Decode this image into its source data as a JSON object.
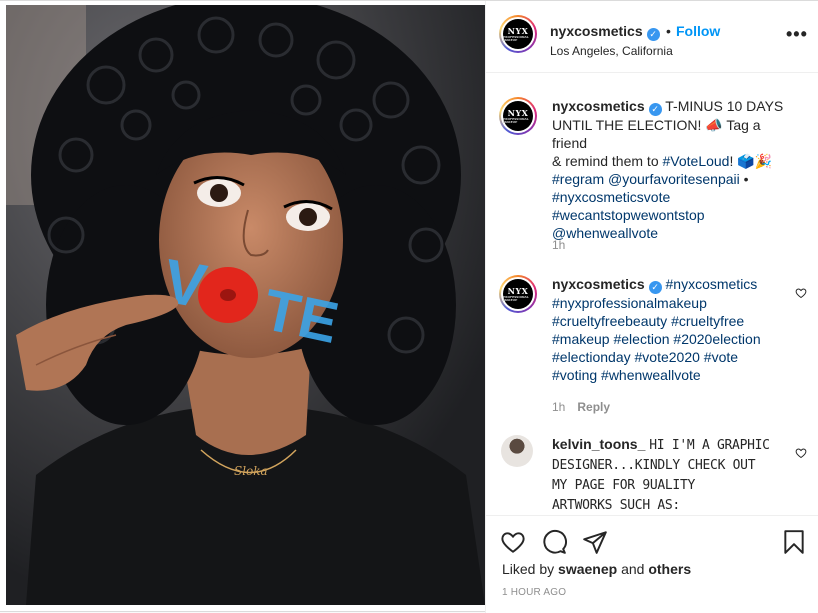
{
  "post": {
    "header": {
      "username": "nyxcosmetics",
      "separator": "•",
      "follow_label": "Follow",
      "location": "Los Angeles, California",
      "more_label": "•••",
      "avatar_logo": "NYX",
      "avatar_sub": "PROFESSIONAL MAKEUP"
    },
    "caption": {
      "username": "nyxcosmetics",
      "text_lines": [
        "T-MINUS 10 DAYS",
        "UNTIL THE ELECTION! 📣 Tag a friend",
        "& remind them to ",
        "#VoteLoud",
        "! 🗳️🎉",
        "#regram @yourfavoritesenpaii",
        " •",
        "#nyxcosmeticsvote",
        "#wecantstopwewontstop",
        "@whenweallvote"
      ],
      "time": "1h"
    },
    "hashtag_comment": {
      "username": "nyxcosmetics",
      "tags": [
        "#nyxcosmetics",
        "#nyxprofessionalmakeup",
        "#crueltyfreebeauty #crueltyfree",
        "#makeup #election #2020election",
        "#electionday #vote2020 #vote",
        "#voting #whenweallvote"
      ],
      "time": "1h",
      "reply_label": "Reply"
    },
    "kelvin_comment": {
      "username": "kelvin_toons_",
      "lines": [
        "HI I'M A GRAPHIC",
        "DESIGNER...KINDLY CHECK OUT",
        "MY PAGE FOR 9UALITY",
        "ARTWORKS SUCH AS:"
      ]
    },
    "likes": {
      "prefix": "Liked by ",
      "user": "swaenep",
      "middle": " and ",
      "others": "others"
    },
    "timestamp": "1 HOUR AGO",
    "photo_text": {
      "cheek_left": "V",
      "cheek_right": "TE"
    }
  },
  "colors": {
    "accent": "#0095f6",
    "verified": "#3897f0",
    "hashtag": "#00376b",
    "muted": "#8e8e8e"
  },
  "icons": [
    "heart-icon",
    "comment-icon",
    "share-icon",
    "bookmark-icon",
    "verified-icon",
    "more-options-icon"
  ]
}
